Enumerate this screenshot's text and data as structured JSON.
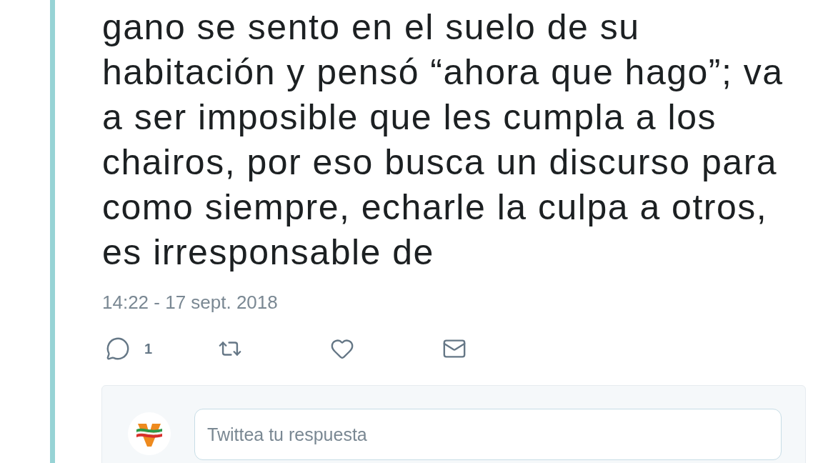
{
  "tweet": {
    "text": "gano se sento en el suelo de su\nhabitación y pensó “ahora que hago”; va\na ser imposible que les cumpla a los\nchairos, por eso busca un discurso para\ncomo siempre, echarle la culpa a otros,\nes irresponsable de",
    "timestamp": "14:22 - 17 sept. 2018",
    "actions": [
      {
        "kind": "reply",
        "count": "1"
      },
      {
        "kind": "retweet"
      },
      {
        "kind": "like"
      },
      {
        "kind": "message"
      }
    ]
  },
  "reply_box": {
    "placeholder": "Twittea tu respuesta"
  }
}
